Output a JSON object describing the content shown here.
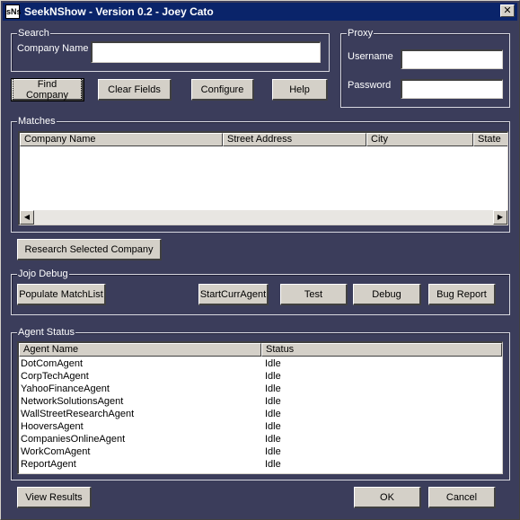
{
  "window": {
    "title": "SeekNShow - Version 0.2 - Joey Cato",
    "icon_text": "sNs",
    "close_glyph": "✕"
  },
  "search": {
    "legend": "Search",
    "company_label": "Company Name",
    "company_value": ""
  },
  "proxy": {
    "legend": "Proxy",
    "username_label": "Username",
    "username_value": "",
    "password_label": "Password",
    "password_value": ""
  },
  "buttons": {
    "find_company": "Find Company",
    "clear_fields": "Clear Fields",
    "configure": "Configure",
    "help": "Help",
    "research_selected": "Research Selected Company",
    "populate_matchlist": "Populate MatchList",
    "start_curr_agent": "StartCurrAgent",
    "test": "Test",
    "debug": "Debug",
    "bug_report": "Bug Report",
    "view_results": "View Results",
    "ok": "OK",
    "cancel": "Cancel"
  },
  "matches": {
    "legend": "Matches",
    "columns": [
      "Company Name",
      "Street Address",
      "City",
      "State"
    ],
    "rows": [],
    "scroll_left_glyph": "◀",
    "scroll_right_glyph": "▶"
  },
  "debug": {
    "legend": "Jojo Debug"
  },
  "agent_status": {
    "legend": "Agent Status",
    "columns": [
      "Agent Name",
      "Status"
    ],
    "rows": [
      {
        "name": "DotComAgent",
        "status": "Idle"
      },
      {
        "name": "CorpTechAgent",
        "status": "Idle"
      },
      {
        "name": "YahooFinanceAgent",
        "status": "Idle"
      },
      {
        "name": "NetworkSolutionsAgent",
        "status": "Idle"
      },
      {
        "name": "WallStreetResearchAgent",
        "status": "Idle"
      },
      {
        "name": "HooversAgent",
        "status": "Idle"
      },
      {
        "name": "CompaniesOnlineAgent",
        "status": "Idle"
      },
      {
        "name": "WorkComAgent",
        "status": "Idle"
      },
      {
        "name": "ReportAgent",
        "status": "Idle"
      }
    ]
  },
  "colors": {
    "dialog_background": "#3b3d5b",
    "titlebar": "#0a246a",
    "button_face": "#d4d0c8"
  }
}
